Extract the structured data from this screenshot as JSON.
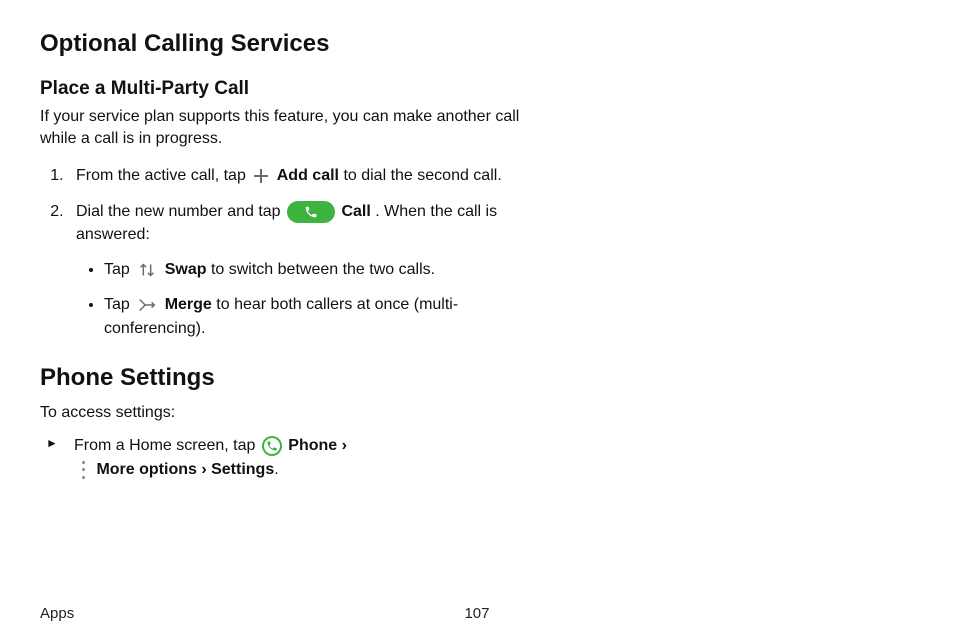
{
  "h1": "Optional Calling Services",
  "h2": "Place a Multi-Party Call",
  "lead": "If your service plan supports this feature, you can make another call while a call is in progress.",
  "steps": {
    "s1_pre": "From the active call, tap ",
    "s1_bold": "Add call",
    "s1_post": " to dial the second call.",
    "s2_pre": "Dial the new number and tap ",
    "s2_bold": "Call",
    "s2_post": ". When the call is answered:"
  },
  "sub": {
    "a_pre": "Tap ",
    "a_bold": "Swap",
    "a_post": " to switch between the two calls.",
    "b_pre": "Tap ",
    "b_bold": "Merge",
    "b_post": " to hear both callers at once (multi-conferencing)."
  },
  "phone_settings_h": "Phone Settings",
  "phone_settings_lead": "To access settings:",
  "nav": {
    "pre": "From a Home screen, tap ",
    "phone": "Phone",
    "chev": " › ",
    "more": "More options",
    "chev2": " › ",
    "settings": "Settings",
    "dot": "."
  },
  "footer": {
    "left": "Apps",
    "page": "107"
  }
}
